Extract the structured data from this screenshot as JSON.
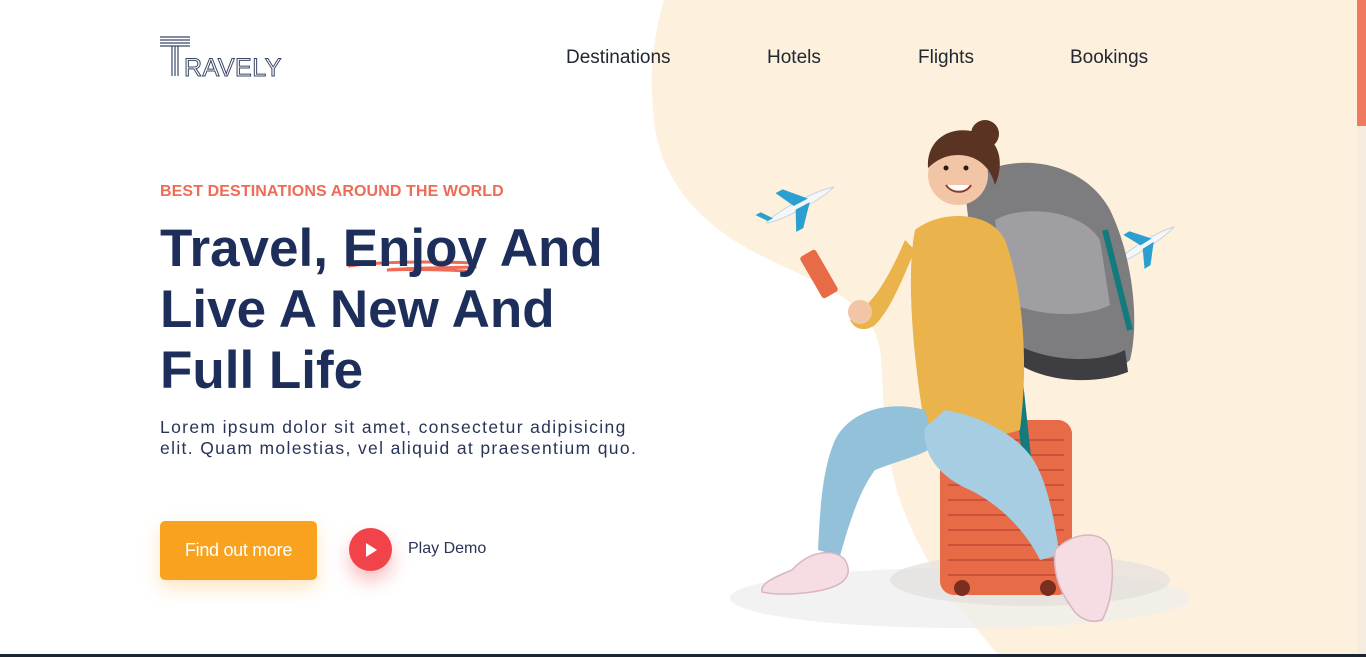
{
  "brand": {
    "logo_text": "TRAVELY",
    "accent": "#ee6b55",
    "cta_color": "#f9a21f",
    "play_color": "#f2434a",
    "blob_color": "#fdf1de",
    "heading_color": "#1d2e5a"
  },
  "nav": {
    "items": [
      {
        "label": "Destinations"
      },
      {
        "label": "Hotels"
      },
      {
        "label": "Flights"
      },
      {
        "label": "Bookings"
      }
    ]
  },
  "hero": {
    "eyebrow": "BEST DESTINATIONS AROUND THE WORLD",
    "headline": {
      "line1_before": "Travel, ",
      "line1_highlight": "Enjoy",
      "line1_after": " And",
      "line2": "Live A New And",
      "line3": "Full Life"
    },
    "lead": "Lorem ipsum dolor sit amet, consectetur adipisicing elit. Quam molestias, vel aliquid at praesentium quo.",
    "primary_cta": "Find out more",
    "secondary_cta": "Play Demo"
  },
  "icons": {
    "play": "play-icon",
    "plane": "airplane-icon",
    "traveler": "traveler-illustration"
  }
}
